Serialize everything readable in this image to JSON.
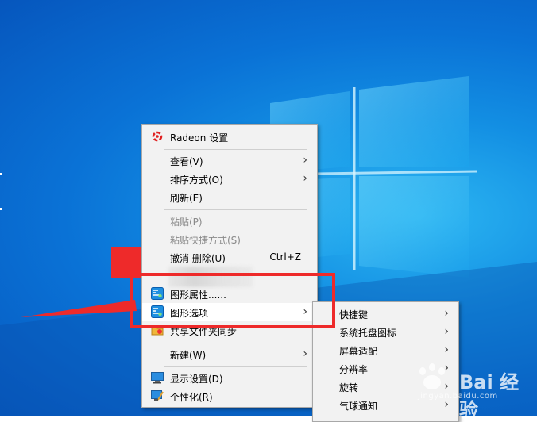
{
  "context_menu": {
    "items": [
      {
        "label": "Radeon 设置"
      },
      {
        "label": "查看(V)"
      },
      {
        "label": "排序方式(O)"
      },
      {
        "label": "刷新(E)"
      },
      {
        "label": "粘贴(P)"
      },
      {
        "label": "粘贴快捷方式(S)"
      },
      {
        "label": "撤消 删除(U)",
        "shortcut": "Ctrl+Z"
      },
      {
        "label": "图形属性......"
      },
      {
        "label": "图形选项"
      },
      {
        "label": "共享文件夹同步"
      },
      {
        "label": "新建(W)"
      },
      {
        "label": "显示设置(D)"
      },
      {
        "label": "个性化(R)"
      }
    ],
    "arrow_glyph": "›"
  },
  "submenu": {
    "items": [
      {
        "label": "快捷键"
      },
      {
        "label": "系统托盘图标"
      },
      {
        "label": "屏幕适配"
      },
      {
        "label": "分辨率"
      },
      {
        "label": "旋转"
      },
      {
        "label": "气球通知"
      }
    ]
  },
  "watermark": {
    "text": "Bai 经验",
    "url": "jingyan.baidu.com"
  },
  "colors": {
    "annotation_red": "#ee2a2a",
    "desktop_blue": "#0a72d6",
    "menu_bg": "#f2f2f2"
  },
  "icons": [
    "radeon-icon",
    "graphics-properties-icon",
    "graphics-options-icon",
    "share-folder-icon",
    "display-settings-icon",
    "personalize-icon"
  ]
}
